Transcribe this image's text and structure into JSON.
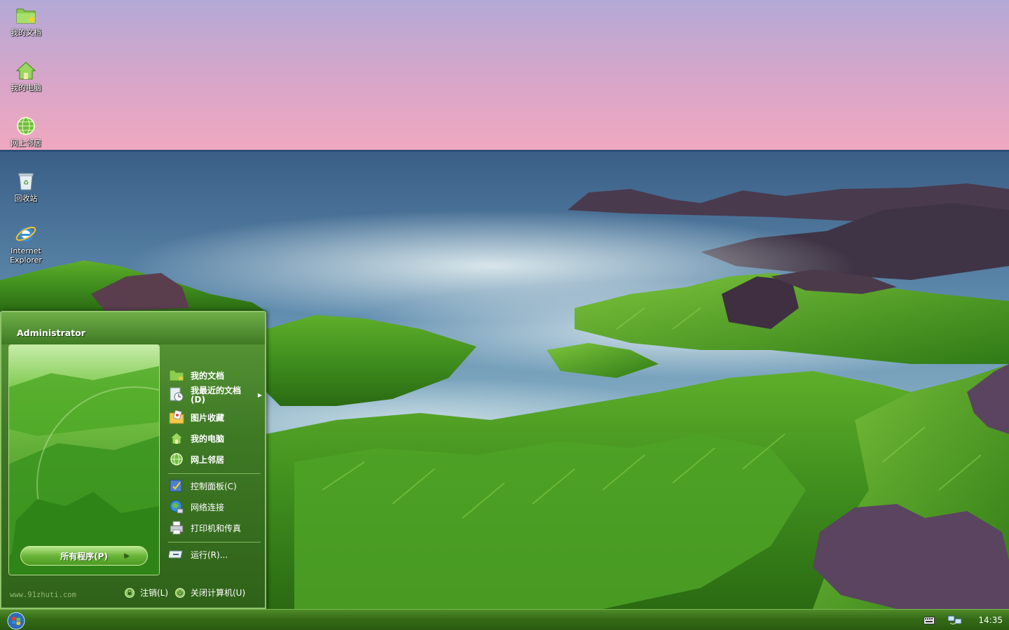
{
  "desktop": {
    "icons": [
      {
        "label": "我的文档",
        "icon": "folder-icon"
      },
      {
        "label": "我的电脑",
        "icon": "home-icon"
      },
      {
        "label": "网上邻居",
        "icon": "globe-icon"
      },
      {
        "label": "回收站",
        "icon": "recycle-bin-icon"
      },
      {
        "label": "Internet\nExplorer",
        "label_line1": "Internet",
        "label_line2": "Explorer",
        "icon": "internet-explorer-icon"
      }
    ]
  },
  "start_menu": {
    "user": "Administrator",
    "all_programs": "所有程序(P)",
    "items_top": [
      {
        "label": "我的文档",
        "icon": "folder-icon"
      },
      {
        "label_line1": "我最近的文档",
        "label_line2": "(D)",
        "icon": "recent-documents-icon",
        "has_submenu": true
      },
      {
        "label": "图片收藏",
        "icon": "pictures-icon"
      },
      {
        "label": "我的电脑",
        "icon": "home-icon"
      },
      {
        "label": "网上邻居",
        "icon": "globe-icon"
      }
    ],
    "items_mid": [
      {
        "label": "控制面板(C)",
        "icon": "control-panel-icon"
      },
      {
        "label": "网络连接",
        "icon": "network-connections-icon"
      },
      {
        "label": "打印机和传真",
        "icon": "printer-icon"
      }
    ],
    "run": {
      "label": "运行(R)...",
      "icon": "run-icon"
    },
    "footer": {
      "url": "www.91zhuti.com",
      "logoff": "注销(L)",
      "shutdown": "关闭计算机(U)"
    }
  },
  "taskbar": {
    "clock": "14:35"
  },
  "colors": {
    "theme_green": "#3f7a25",
    "taskbar_green": "#356b17",
    "sky_pink": "#e8a0c0",
    "sea_blue": "#3d6a8a"
  }
}
